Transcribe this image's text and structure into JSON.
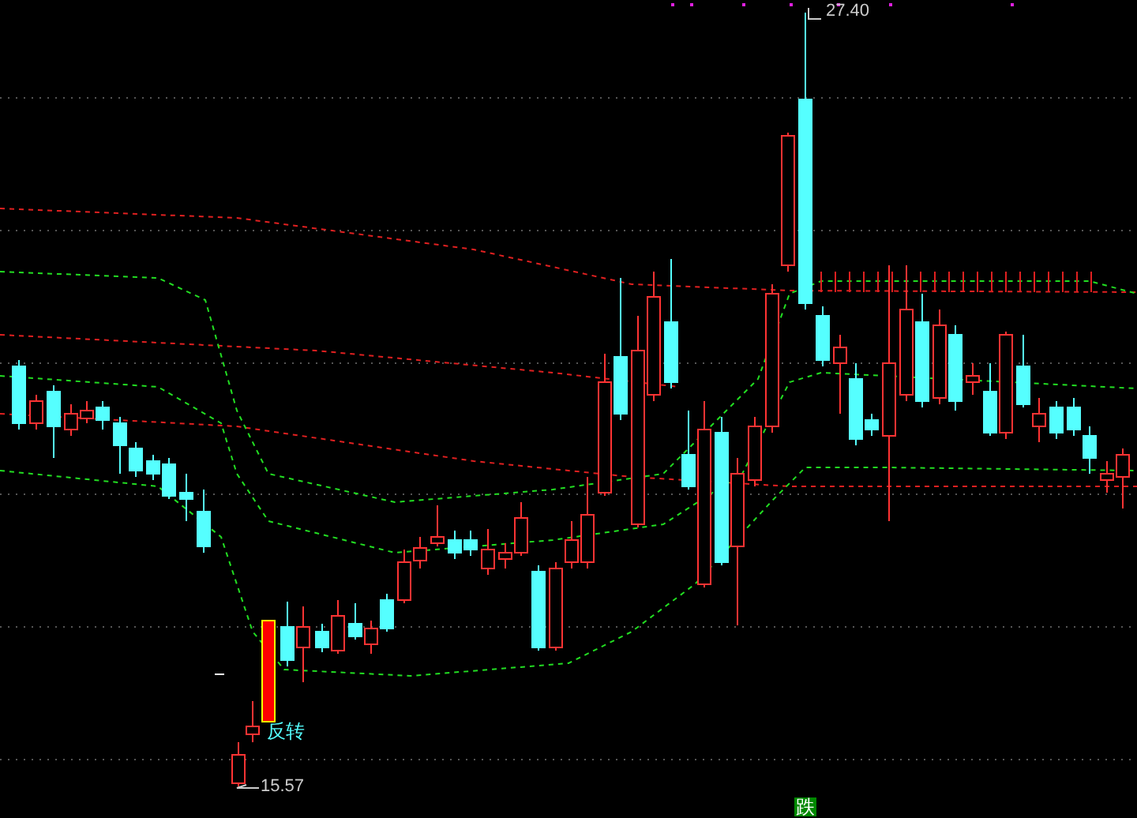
{
  "chart": {
    "high_label": "27.40",
    "low_label": "15.57",
    "signal_label": "反转",
    "signal_badge": "跌"
  }
}
